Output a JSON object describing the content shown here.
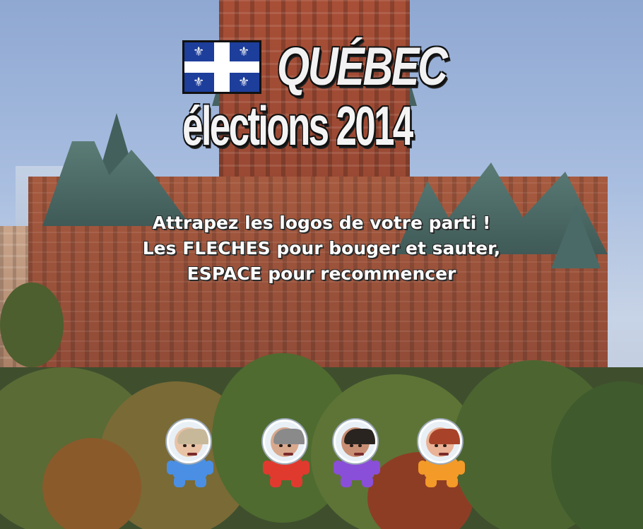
{
  "title": {
    "line1": "QUÉBEC",
    "line2": "élections 2014",
    "flag_icon": "quebec-flag-icon"
  },
  "instructions": [
    "Attrapez les logos de votre parti !",
    "Les FLECHES pour bouger et sauter,",
    "ESPACE pour recommencer"
  ],
  "characters": [
    {
      "color": "#4a8fe3",
      "hair": "#c7b89a",
      "skin": "#e9c3a6"
    },
    {
      "color": "#e03a2f",
      "hair": "#8a8a8a",
      "skin": "#d9a98e"
    },
    {
      "color": "#8a4fd8",
      "hair": "#2a2420",
      "skin": "#c98f75"
    },
    {
      "color": "#f39a28",
      "hair": "#a8432a",
      "skin": "#eab296"
    }
  ]
}
